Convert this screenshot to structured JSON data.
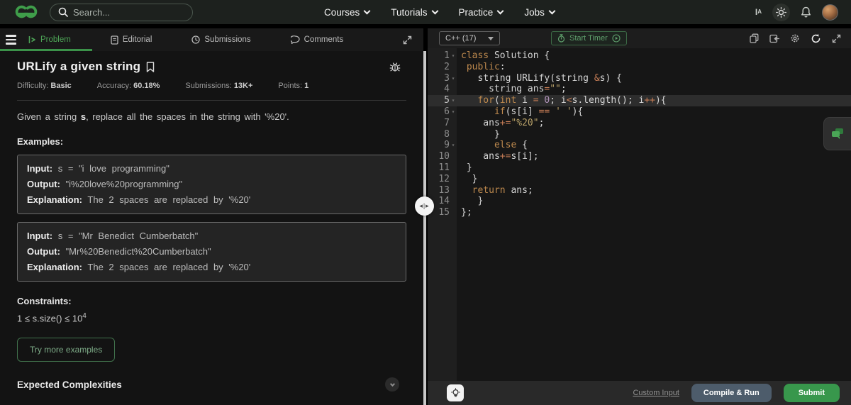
{
  "navbar": {
    "search_placeholder": "Search...",
    "links": [
      "Courses",
      "Tutorials",
      "Practice",
      "Jobs"
    ],
    "icons": [
      "translate-icon",
      "theme-toggle-icon",
      "notifications-icon",
      "avatar"
    ]
  },
  "tabs": [
    {
      "label": "Problem",
      "icon": "problem-icon",
      "active": true
    },
    {
      "label": "Editorial",
      "icon": "editorial-icon",
      "active": false
    },
    {
      "label": "Submissions",
      "icon": "submissions-icon",
      "active": false
    },
    {
      "label": "Comments",
      "icon": "comments-icon",
      "active": false
    }
  ],
  "problem": {
    "title": "URLify a given string",
    "meta": [
      {
        "label": "Difficulty:",
        "value": "Basic"
      },
      {
        "label": "Accuracy:",
        "value": "60.18%"
      },
      {
        "label": "Submissions:",
        "value": "13K+"
      },
      {
        "label": "Points:",
        "value": "1"
      }
    ],
    "statement_prefix": "Given a string ",
    "statement_s": "s",
    "statement_suffix": ", replace all the spaces in the string with '%20'.",
    "examples_heading": "Examples:",
    "example_labels": {
      "input": "Input:",
      "output": "Output:",
      "explanation": "Explanation:"
    },
    "examples": [
      {
        "input": "s = \"i love programming\"",
        "output": "\"i%20love%20programming\"",
        "explanation": "The 2 spaces are replaced by '%20'"
      },
      {
        "input": "s = \"Mr Benedict Cumberbatch\"",
        "output": "\"Mr%20Benedict%20Cumberbatch\"",
        "explanation": "The 2 spaces are replaced by '%20'"
      }
    ],
    "constraints_heading": "Constraints:",
    "constraint_base": "1 ≤ s.size() ≤ 10",
    "constraint_exponent": "4",
    "try_more_label": "Try more examples",
    "expected_heading": "Expected Complexities"
  },
  "editor": {
    "language": "C++ (17)",
    "start_timer_label": "Start Timer",
    "header_icons": [
      "copy-icon",
      "format-code-icon",
      "settings-gear-icon",
      "reset-code-icon",
      "fullscreen-icon"
    ],
    "code": {
      "active_line": 5,
      "folds": [
        1,
        3,
        5,
        6,
        9
      ],
      "lines": [
        [
          [
            "class",
            "k"
          ],
          [
            " Solution {",
            "p"
          ]
        ],
        [
          [
            " ",
            "p"
          ],
          [
            "public",
            "k"
          ],
          [
            ":",
            "p"
          ]
        ],
        [
          [
            "   string URLify(string ",
            "p"
          ],
          [
            "&",
            "o"
          ],
          [
            "s) {",
            "p"
          ]
        ],
        [
          [
            "     string ans",
            "p"
          ],
          [
            "=",
            "o"
          ],
          [
            "\"\"",
            "s"
          ],
          [
            ";",
            "p"
          ]
        ],
        [
          [
            "   ",
            "p"
          ],
          [
            "for",
            "k"
          ],
          [
            "(",
            "p"
          ],
          [
            "int",
            "k"
          ],
          [
            " i ",
            "p"
          ],
          [
            "=",
            "o"
          ],
          [
            " ",
            "p"
          ],
          [
            "0",
            "n"
          ],
          [
            "; i",
            "p"
          ],
          [
            "<",
            "o"
          ],
          [
            "s.length(); i",
            "p"
          ],
          [
            "++",
            "o"
          ],
          [
            "){",
            "p"
          ]
        ],
        [
          [
            "      ",
            "p"
          ],
          [
            "if",
            "k"
          ],
          [
            "(s[i] ",
            "p"
          ],
          [
            "==",
            "o"
          ],
          [
            " ",
            "p"
          ],
          [
            "' '",
            "s"
          ],
          [
            "){",
            "p"
          ]
        ],
        [
          [
            "    ans",
            "p"
          ],
          [
            "+=",
            "o"
          ],
          [
            "\"%20\"",
            "s"
          ],
          [
            ";",
            "p"
          ]
        ],
        [
          [
            "      }",
            "p"
          ]
        ],
        [
          [
            "      ",
            "p"
          ],
          [
            "else",
            "k"
          ],
          [
            " {",
            "p"
          ]
        ],
        [
          [
            "    ans",
            "p"
          ],
          [
            "+=",
            "o"
          ],
          [
            "s[i];",
            "p"
          ]
        ],
        [
          [
            " }",
            "p"
          ]
        ],
        [
          [
            "  }",
            "p"
          ]
        ],
        [
          [
            "  ",
            "p"
          ],
          [
            "return",
            "k"
          ],
          [
            " ans;",
            "p"
          ]
        ],
        [
          [
            "   }",
            "p"
          ]
        ],
        [
          [
            "};",
            "p"
          ]
        ]
      ]
    },
    "footer": {
      "custom_input_label": "Custom Input",
      "compile_run_label": "Compile & Run",
      "submit_label": "Submit",
      "hint_icon": "lightbulb-icon"
    }
  },
  "floating": {
    "chat_icon": "chat-feedback-icon"
  },
  "colors": {
    "accent_green": "#2f8d46",
    "tab_active_green": "#4da356",
    "submit_green": "#38974c",
    "compile_slate": "#4d5c6b",
    "timer_green": "#5f9f6c",
    "syntax": {
      "keyword": "#bf8a4e",
      "operator": "#c97f57",
      "string": "#b9a269",
      "number": "#b294bb",
      "plain": "#d6d6d6"
    }
  }
}
